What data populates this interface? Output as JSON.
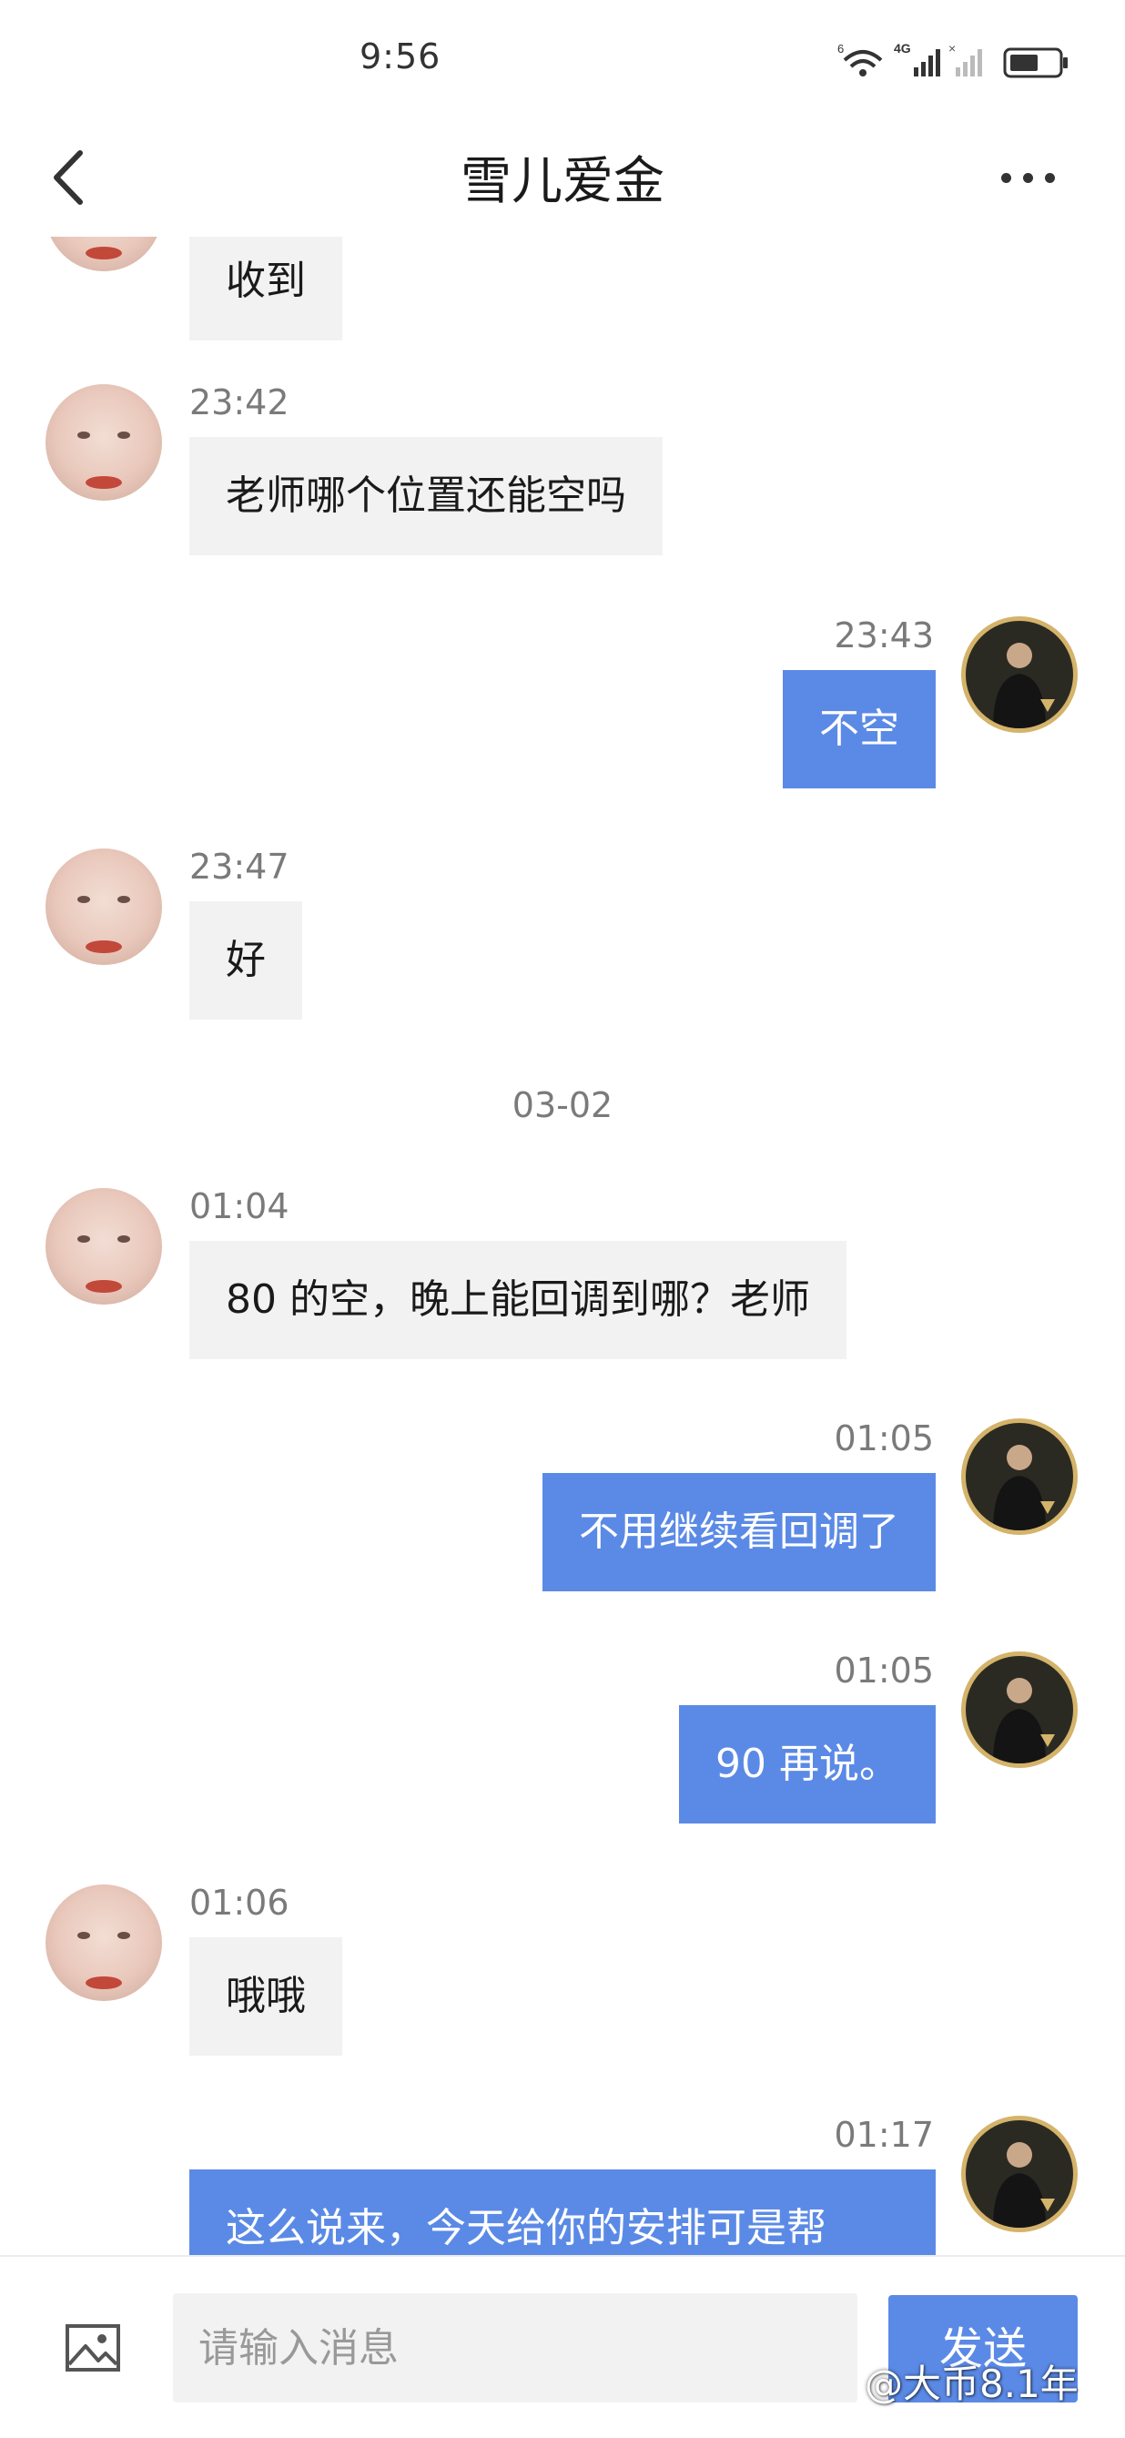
{
  "status_bar": {
    "time": "9:56",
    "network_label": "4G",
    "sim_label": "6"
  },
  "header": {
    "title": "雪儿爱金",
    "back_icon": "chevron-left-icon",
    "more_icon": "more-dots-icon"
  },
  "messages": {
    "m0": {
      "text": "收到"
    },
    "m1": {
      "time": "23:42",
      "text": "老师哪个位置还能空吗"
    },
    "m2": {
      "time": "23:43",
      "text": "不空"
    },
    "m3": {
      "time": "23:47",
      "text": "好"
    },
    "date_divider": "03-02",
    "m4": {
      "time": "01:04",
      "text": "80 的空，晚上能回调到哪？老师"
    },
    "m5": {
      "time": "01:05",
      "text": "不用继续看回调了"
    },
    "m6": {
      "time": "01:05",
      "text": "90 再说。"
    },
    "m7": {
      "time": "01:06",
      "text": "哦哦"
    },
    "m8": {
      "time": "01:17",
      "text": "这么说来，今天给你的安排可是帮"
    }
  },
  "input_bar": {
    "placeholder": "请输入消息",
    "send_label": "发送",
    "image_icon": "image-icon"
  },
  "watermark": "@大币8.1年",
  "colors": {
    "outgoing_bubble": "#5b8ae6",
    "incoming_bubble": "#f2f2f2",
    "timestamp": "#7a7a7a",
    "avatar_ring": "#d4b36a"
  }
}
